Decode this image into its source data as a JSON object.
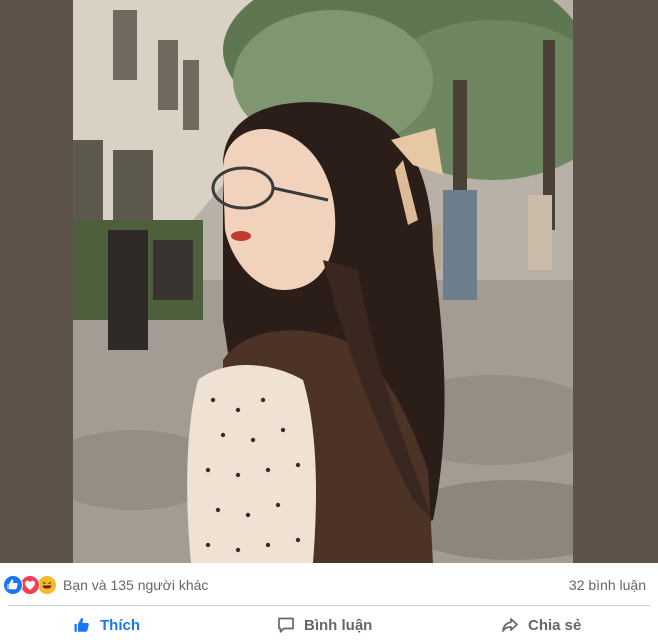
{
  "reactions": {
    "icons": [
      "like-icon",
      "love-icon",
      "haha-icon"
    ],
    "summary": "Bạn và 135 người khác",
    "comments": "32 bình luận"
  },
  "actions": {
    "like_label": "Thích",
    "comment_label": "Bình luận",
    "share_label": "Chia sẻ"
  },
  "colors": {
    "accent": "#1877f2",
    "muted_text": "#65676b",
    "photo_backdrop": "#5e534b"
  }
}
